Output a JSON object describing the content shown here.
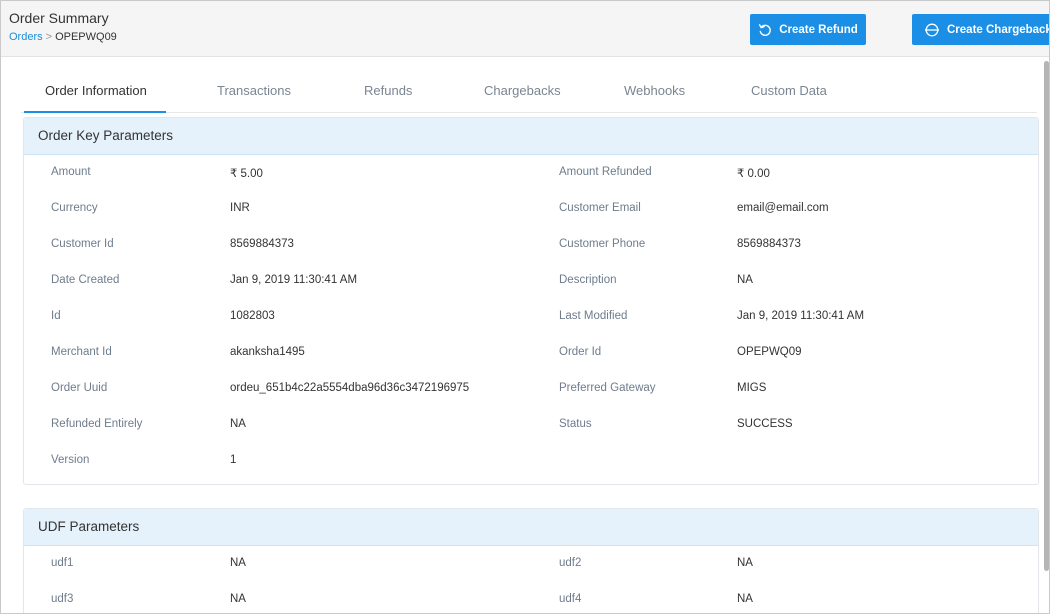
{
  "header": {
    "title": "Order Summary",
    "breadcrumb": {
      "link": "Orders",
      "separator": ">",
      "current": "OPEPWQ09"
    },
    "buttons": {
      "create_refund": "Create Refund",
      "create_chargeback": "Create Chargeback"
    }
  },
  "tabs": [
    {
      "label": "Order Information",
      "active": true
    },
    {
      "label": "Transactions",
      "active": false
    },
    {
      "label": "Refunds",
      "active": false
    },
    {
      "label": "Chargebacks",
      "active": false
    },
    {
      "label": "Webhooks",
      "active": false
    },
    {
      "label": "Custom Data",
      "active": false
    }
  ],
  "order_key_parameters": {
    "title": "Order Key Parameters",
    "rows": [
      [
        {
          "label": "Amount",
          "value": "₹ 5.00"
        },
        {
          "label": "Amount Refunded",
          "value": "₹ 0.00"
        }
      ],
      [
        {
          "label": "Currency",
          "value": "INR"
        },
        {
          "label": "Customer Email",
          "value": "email@email.com"
        }
      ],
      [
        {
          "label": "Customer Id",
          "value": "8569884373"
        },
        {
          "label": "Customer Phone",
          "value": "8569884373"
        }
      ],
      [
        {
          "label": "Date Created",
          "value": "Jan 9, 2019 11:30:41 AM"
        },
        {
          "label": "Description",
          "value": "NA"
        }
      ],
      [
        {
          "label": "Id",
          "value": "1082803"
        },
        {
          "label": "Last Modified",
          "value": "Jan 9, 2019 11:30:41 AM"
        }
      ],
      [
        {
          "label": "Merchant Id",
          "value": "akanksha1495"
        },
        {
          "label": "Order Id",
          "value": "OPEPWQ09"
        }
      ],
      [
        {
          "label": "Order Uuid",
          "value": "ordeu_651b4c22a5554dba96d36c3472196975"
        },
        {
          "label": "Preferred Gateway",
          "value": "MIGS"
        }
      ],
      [
        {
          "label": "Refunded Entirely",
          "value": "NA"
        },
        {
          "label": "Status",
          "value": "SUCCESS"
        }
      ],
      [
        {
          "label": "Version",
          "value": "1"
        }
      ]
    ]
  },
  "udf_parameters": {
    "title": "UDF Parameters",
    "rows": [
      [
        {
          "label": "udf1",
          "value": "NA"
        },
        {
          "label": "udf2",
          "value": "NA"
        }
      ],
      [
        {
          "label": "udf3",
          "value": "NA"
        },
        {
          "label": "udf4",
          "value": "NA"
        }
      ]
    ]
  },
  "colors": {
    "accent": "#1b8fe6",
    "link": "#1e8bd8",
    "panel_header_bg": "#e6f2fb",
    "label_text": "#6e7c8c"
  },
  "icons": {
    "refund": "refresh-ccw-icon",
    "chargeback": "card-icon"
  }
}
